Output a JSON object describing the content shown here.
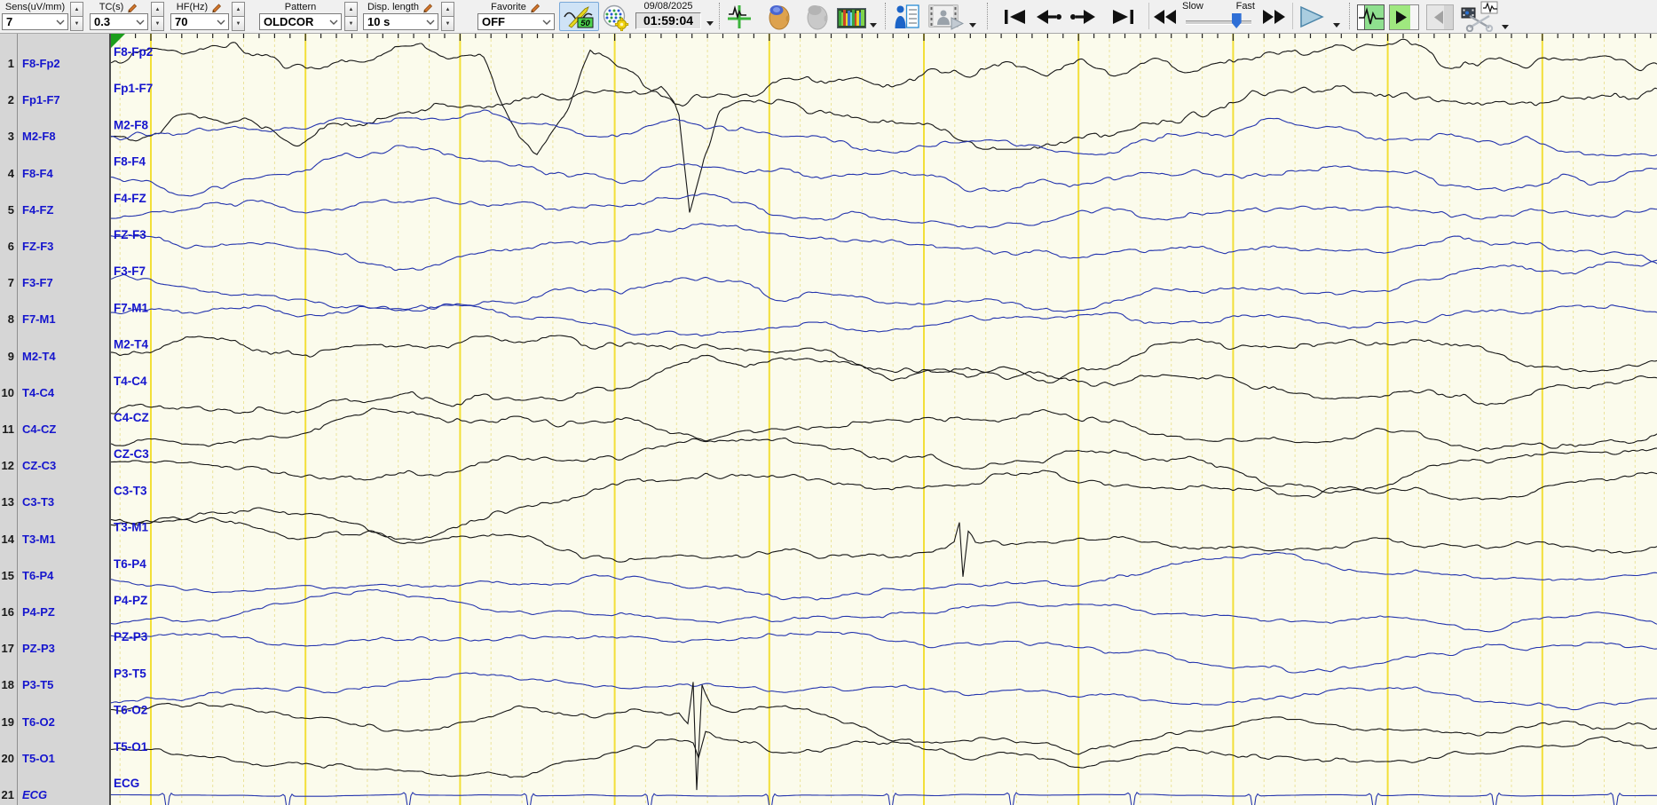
{
  "toolbar": {
    "combos": [
      {
        "label": "Sens(uV/mm)",
        "value": "7",
        "pencil": false,
        "spinner": true
      },
      {
        "label": "TC(s)",
        "value": "0.3",
        "pencil": true,
        "spinner": true
      },
      {
        "label": "HF(Hz)",
        "value": "70",
        "pencil": true,
        "spinner": true
      },
      {
        "label": "Pattern",
        "value": "OLDCOR",
        "pencil": false,
        "spinner": true
      },
      {
        "label": "Disp. length",
        "value": "10 s",
        "pencil": true,
        "spinner": true
      },
      {
        "label": "Favorite",
        "value": "OFF",
        "pencil": true,
        "spinner": false
      }
    ],
    "notch_badge": "50",
    "datetime": {
      "date": "09/08/2025",
      "time": "01:59:04"
    },
    "speed_slider": {
      "left_label": "Slow",
      "right_label": "Fast",
      "position": 0.82
    },
    "icons": [
      "pencil-icon",
      "notch-filter-50hz-icon",
      "montage-settings-icon",
      "event-marker-icon",
      "brain-map-3d-icon",
      "brain-map-3d-disabled-icon",
      "dsa-spectrogram-icon",
      "patient-info-icon",
      "video-icon",
      "skip-to-start-icon",
      "previous-event-icon",
      "next-event-icon",
      "skip-to-end-icon",
      "rewind-icon",
      "fast-forward-icon",
      "play-outline-icon",
      "review-play-icon",
      "play-forward-icon",
      "step-back-disabled-icon",
      "clip-scissors-icon"
    ]
  },
  "channels": [
    {
      "num": "1",
      "label": "F8-Fp2",
      "color": "black"
    },
    {
      "num": "2",
      "label": "Fp1-F7",
      "color": "black"
    },
    {
      "num": "3",
      "label": "M2-F8",
      "color": "blue"
    },
    {
      "num": "4",
      "label": "F8-F4",
      "color": "blue"
    },
    {
      "num": "5",
      "label": "F4-FZ",
      "color": "blue"
    },
    {
      "num": "6",
      "label": "FZ-F3",
      "color": "blue"
    },
    {
      "num": "7",
      "label": "F3-F7",
      "color": "blue"
    },
    {
      "num": "8",
      "label": "F7-M1",
      "color": "blue"
    },
    {
      "num": "9",
      "label": "M2-T4",
      "color": "black"
    },
    {
      "num": "10",
      "label": "T4-C4",
      "color": "black"
    },
    {
      "num": "11",
      "label": "C4-CZ",
      "color": "black"
    },
    {
      "num": "12",
      "label": "CZ-C3",
      "color": "black"
    },
    {
      "num": "13",
      "label": "C3-T3",
      "color": "black"
    },
    {
      "num": "14",
      "label": "T3-M1",
      "color": "black"
    },
    {
      "num": "15",
      "label": "T6-P4",
      "color": "blue"
    },
    {
      "num": "16",
      "label": "P4-PZ",
      "color": "blue"
    },
    {
      "num": "17",
      "label": "PZ-P3",
      "color": "blue"
    },
    {
      "num": "18",
      "label": "P3-T5",
      "color": "blue"
    },
    {
      "num": "19",
      "label": "T6-O2",
      "color": "black"
    },
    {
      "num": "20",
      "label": "T5-O1",
      "color": "black"
    },
    {
      "num": "21",
      "label": "ECG",
      "color": "blue",
      "italic": true
    }
  ],
  "plot": {
    "display_seconds": 10,
    "grid_major_interval_s": 1,
    "grid_minor_interval_s": 0.2,
    "colors": {
      "background": "#fbfbec",
      "grid_major": "#f2df38",
      "grid_minor": "#ebe39b",
      "trace_black": "#161616",
      "trace_blue": "#2434ad",
      "channel_label": "#1515cd",
      "page_marker_green": "#1c9e1c"
    }
  }
}
